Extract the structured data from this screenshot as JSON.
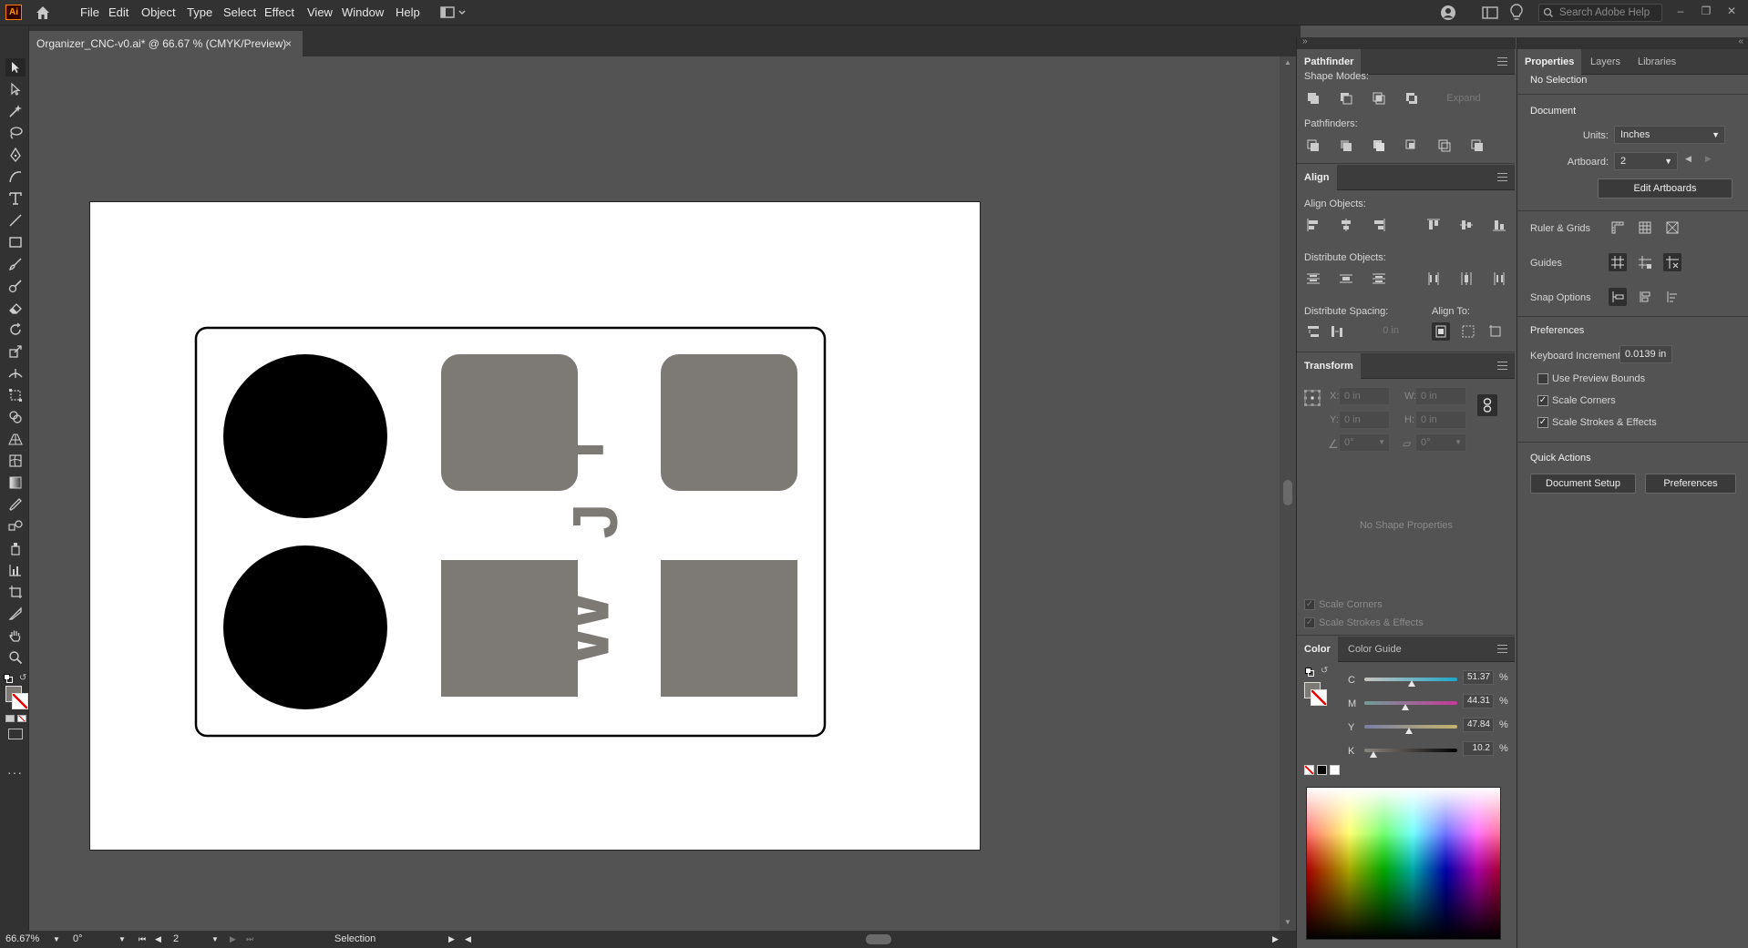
{
  "app": {
    "logo": "Ai"
  },
  "menubar": {
    "items": [
      "File",
      "Edit",
      "Object",
      "Type",
      "Select",
      "Effect",
      "View",
      "Window",
      "Help"
    ],
    "search_placeholder": "Search Adobe Help"
  },
  "document": {
    "tab_title": "Organizer_CNC-v0.ai* @ 66.67 % (CMYK/Preview)",
    "close": "×"
  },
  "artwork": {
    "letters": [
      "T",
      "J",
      "W"
    ],
    "fill_gray": "#7d7975"
  },
  "statusbar": {
    "zoom": "66.67%",
    "rotation": "0°",
    "artboard": "2",
    "tool": "Selection"
  },
  "pathfinder": {
    "tab": "Pathfinder",
    "shape_modes_label": "Shape Modes:",
    "expand_label": "Expand",
    "pathfinders_label": "Pathfinders:"
  },
  "align": {
    "tab": "Align",
    "align_objects_label": "Align Objects:",
    "distribute_objects_label": "Distribute Objects:",
    "distribute_spacing_label": "Distribute Spacing:",
    "align_to_label": "Align To:",
    "spacing_value": "0 in"
  },
  "transform": {
    "tab": "Transform",
    "x_label": "X:",
    "x_value": "0 in",
    "y_label": "Y:",
    "y_value": "0 in",
    "w_label": "W:",
    "w_value": "0 in",
    "h_label": "H:",
    "h_value": "0 in",
    "angle_value": "0°",
    "shear_value": "0°",
    "no_shape": "No Shape Properties",
    "scale_corners": "Scale Corners",
    "scale_strokes": "Scale Strokes & Effects"
  },
  "color": {
    "tabs": [
      "Color",
      "Color Guide"
    ],
    "channels": [
      {
        "label": "C",
        "value": "51.37",
        "level": 0.5137
      },
      {
        "label": "M",
        "value": "44.31",
        "level": 0.4431
      },
      {
        "label": "Y",
        "value": "47.84",
        "level": 0.4784
      },
      {
        "label": "K",
        "value": "10.2",
        "level": 0.102
      }
    ],
    "percent": "%"
  },
  "properties": {
    "tabs": [
      "Properties",
      "Layers",
      "Libraries"
    ],
    "no_selection": "No Selection",
    "document_label": "Document",
    "units_label": "Units:",
    "units_value": "Inches",
    "artboard_label": "Artboard:",
    "artboard_value": "2",
    "edit_artboards": "Edit Artboards",
    "ruler_grids": "Ruler & Grids",
    "guides": "Guides",
    "snap_options": "Snap Options",
    "preferences_label": "Preferences",
    "keyboard_increment_label": "Keyboard Increment:",
    "keyboard_increment_value": "0.0139 in",
    "use_preview_bounds": "Use Preview Bounds",
    "scale_corners": "Scale Corners",
    "scale_strokes": "Scale Strokes & Effects",
    "quick_actions": "Quick Actions",
    "document_setup": "Document Setup",
    "preferences_button": "Preferences"
  }
}
